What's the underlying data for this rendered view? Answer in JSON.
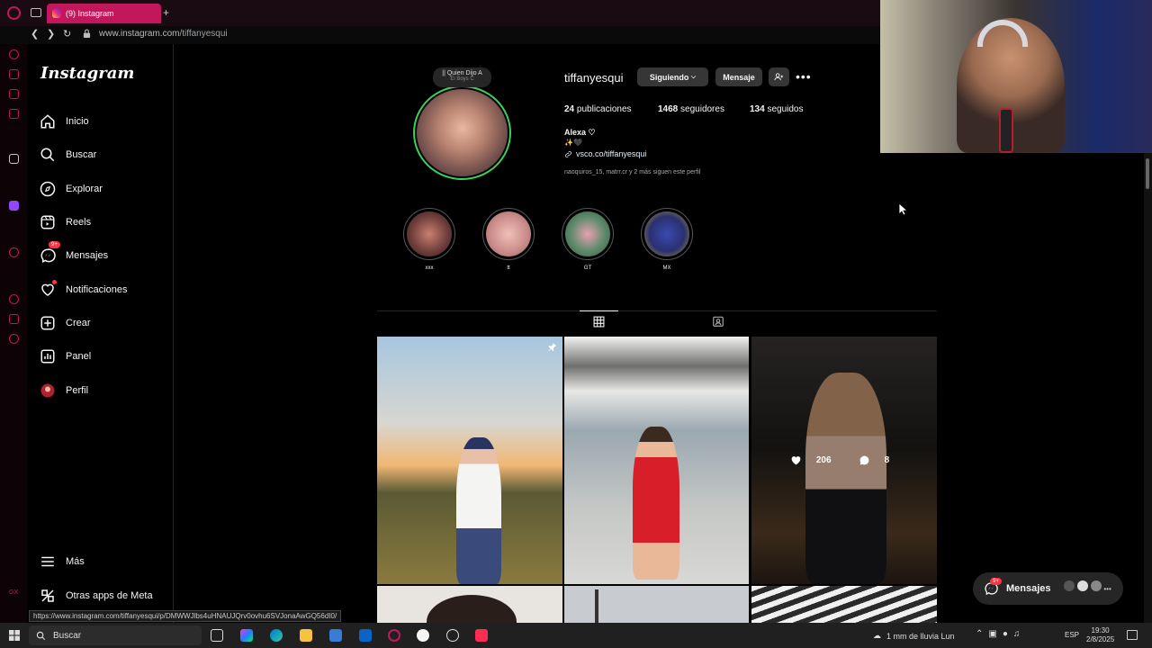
{
  "browser": {
    "tab_title": "(9) Instagram",
    "new_tab": "+",
    "url_prefix": "www.instagram.com",
    "url_path": "/tiffanyesqui",
    "hover_url": "https://www.instagram.com/tiffanyesqui/p/DMWWJlbs4uHNAUJQrv0ovhu6SVJonaAwGQ56dI0/"
  },
  "sidebar": {
    "logo": "Instagram",
    "items": [
      {
        "label": "Inicio",
        "icon": "home-icon"
      },
      {
        "label": "Buscar",
        "icon": "search-icon"
      },
      {
        "label": "Explorar",
        "icon": "compass-icon"
      },
      {
        "label": "Reels",
        "icon": "reels-icon"
      },
      {
        "label": "Mensajes",
        "icon": "messenger-icon",
        "badge": "9+"
      },
      {
        "label": "Notificaciones",
        "icon": "heart-icon"
      },
      {
        "label": "Crear",
        "icon": "plus-square-icon"
      },
      {
        "label": "Panel",
        "icon": "chart-icon"
      },
      {
        "label": "Perfil",
        "icon": "avatar-icon"
      }
    ],
    "more": "Más",
    "meta_apps": "Otras apps de Meta"
  },
  "profile": {
    "note_title": "|| Quien Dijo A",
    "note_sub": "El Boys C",
    "username": "tiffanyesqui",
    "btn_following": "Siguiendo",
    "btn_message": "Mensaje",
    "more": "•••",
    "posts_count": "24",
    "posts_label": "publicaciones",
    "followers_count": "1468",
    "followers_label": "seguidores",
    "following_count": "134",
    "following_label": "seguidos",
    "full_name": "Alexa ♡",
    "bio_emoji": "✨🖤",
    "bio_link": "vsco.co/tiffanyesqui",
    "followed_by": "naoquiros_15, matrr.cr y 2 más siguen este perfil"
  },
  "highlights": [
    {
      "label": "xxx"
    },
    {
      "label": "tt"
    },
    {
      "label": "GT"
    },
    {
      "label": "MX"
    }
  ],
  "post3_stats": {
    "likes": "206",
    "comments": "8"
  },
  "messages_pill": {
    "label": "Mensajes",
    "badge": "9+"
  },
  "taskbar": {
    "search": "Buscar",
    "weather": "1 mm de lluvia Lun",
    "lang": "ESP",
    "time": "19:30",
    "date": "2/8/2025"
  },
  "colors": {
    "opera_accent": "#c2185b",
    "ig_badge": "#ff3040",
    "story_ring": "#3ad15a"
  }
}
